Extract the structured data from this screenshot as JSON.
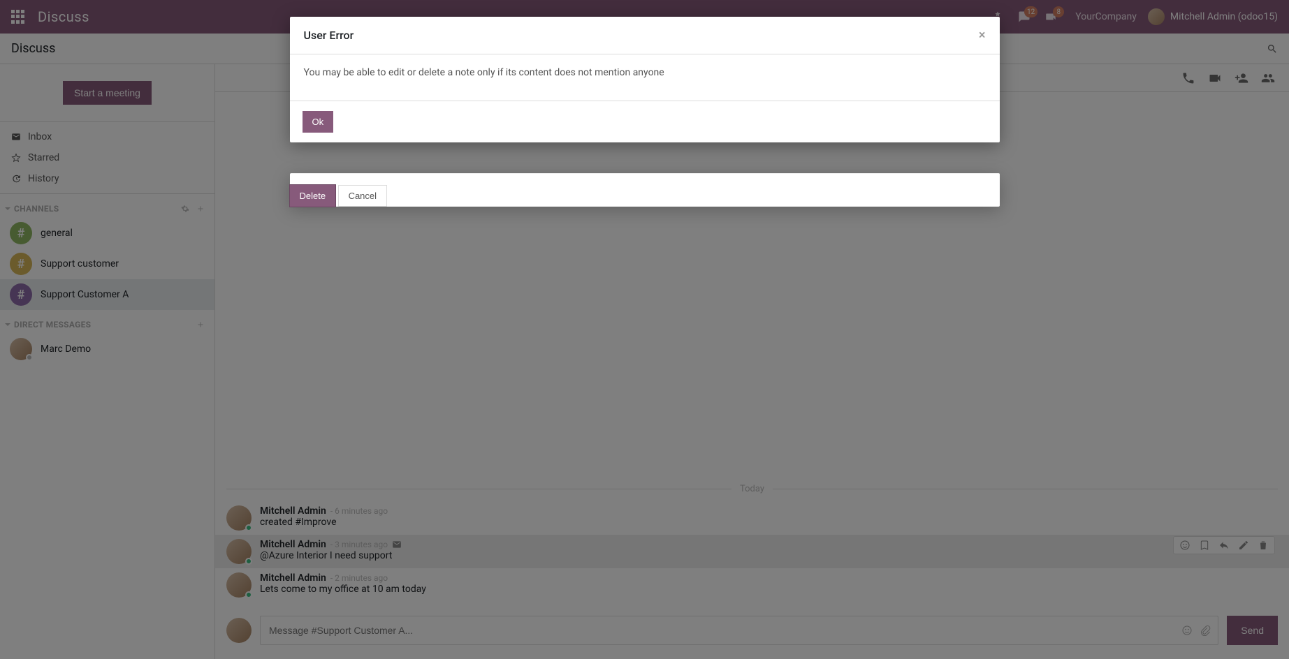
{
  "topnav": {
    "brand": "Discuss",
    "msg_badge": "12",
    "call_badge": "8",
    "company": "YourCompany",
    "user": "Mitchell Admin (odoo15)"
  },
  "controlbar": {
    "title": "Discuss"
  },
  "sidebar": {
    "start_meeting": "Start a meeting",
    "mailboxes": {
      "inbox": "Inbox",
      "starred": "Starred",
      "history": "History"
    },
    "channels_hdr": "CHANNELS",
    "channels": [
      {
        "label": "general"
      },
      {
        "label": "Support customer"
      },
      {
        "label": "Support Customer A"
      }
    ],
    "dm_hdr": "DIRECT MESSAGES",
    "dms": [
      {
        "label": "Marc Demo"
      }
    ]
  },
  "thread": {
    "divider": "Today",
    "messages": [
      {
        "name": "Mitchell Admin",
        "time": "- 6 minutes ago",
        "body": "created #Improve"
      },
      {
        "name": "Mitchell Admin",
        "time": "- 3 minutes ago",
        "body": "@Azure Interior I need support",
        "envelope": true
      },
      {
        "name": "Mitchell Admin",
        "time": "- 2 minutes ago",
        "body": "Lets come to my office at 10 am today"
      }
    ],
    "composer_placeholder": "Message #Support Customer A...",
    "send": "Send"
  },
  "modal_top": {
    "title": "User Error",
    "body": "You may be able to edit or delete a note only if its content does not mention anyone",
    "ok": "Ok"
  },
  "modal_under": {
    "delete": "Delete",
    "cancel": "Cancel"
  }
}
